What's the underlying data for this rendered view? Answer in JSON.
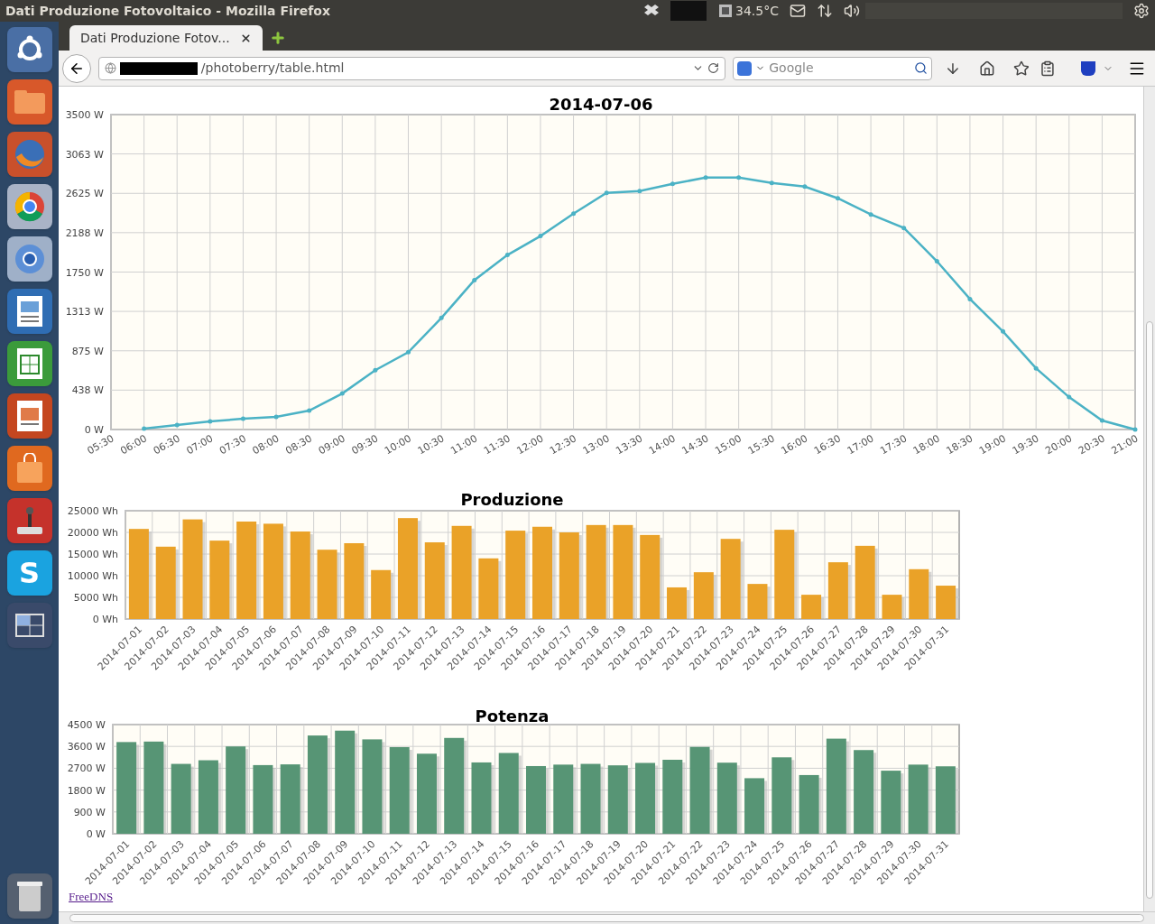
{
  "window": {
    "title": "Dati Produzione Fotovoltaico - Mozilla Firefox"
  },
  "panel": {
    "temperature": "34.5°C"
  },
  "launcher_items": [
    {
      "kind": "ubuntu"
    },
    {
      "kind": "folder"
    },
    {
      "kind": "fox"
    },
    {
      "kind": "ring"
    },
    {
      "kind": "ring-blue"
    },
    {
      "kind": "writer"
    },
    {
      "kind": "calc"
    },
    {
      "kind": "impress"
    },
    {
      "kind": "bag"
    },
    {
      "kind": "joystick"
    },
    {
      "kind": "letter",
      "label": "S"
    },
    {
      "kind": "workspaces"
    },
    {
      "kind": "trash"
    }
  ],
  "tabs": [
    {
      "label": "Dati Produzione Fotov...",
      "selected": true
    }
  ],
  "address_bar": {
    "value": "/photoberry/table.html"
  },
  "search": {
    "placeholder": "Google"
  },
  "charts": [
    {
      "chart_data": {
        "type": "line",
        "grid": true,
        "title": "2014-07-06",
        "categories": [
          "05:30",
          "06:00",
          "06:30",
          "07:00",
          "07:30",
          "08:00",
          "08:30",
          "09:00",
          "09:30",
          "10:00",
          "10:30",
          "11:00",
          "11:30",
          "12:00",
          "12:30",
          "13:00",
          "13:30",
          "14:00",
          "14:30",
          "15:00",
          "15:30",
          "16:00",
          "16:30",
          "17:00",
          "17:30",
          "18:00",
          "18:30",
          "19:00",
          "19:30",
          "20:00",
          "20:30",
          "21:00"
        ],
        "ylim": [
          0,
          3500
        ],
        "yticks": [
          {
            "value": 0,
            "label": "0 W"
          },
          {
            "value": 438,
            "label": "438 W"
          },
          {
            "value": 875,
            "label": "875 W"
          },
          {
            "value": 1313,
            "label": "1313 W"
          },
          {
            "value": 1750,
            "label": "1750 W"
          },
          {
            "value": 2188,
            "label": "2188 W"
          },
          {
            "value": 2625,
            "label": "2625 W"
          },
          {
            "value": 3063,
            "label": "3063 W"
          },
          {
            "value": 3500,
            "label": "3500 W"
          }
        ],
        "series": [
          {
            "color": "#4bb2c5",
            "values": [
              null,
              10,
              50,
              90,
              120,
              140,
              210,
              400,
              660,
              860,
              1240,
              1660,
              1940,
              2150,
              2400,
              2630,
              2650,
              2730,
              2800,
              2800,
              2740,
              2700,
              2570,
              2390,
              2240,
              1870,
              1450,
              1090,
              680,
              360,
              100,
              0
            ]
          }
        ]
      }
    },
    {
      "chart_data": {
        "type": "bar",
        "grid": true,
        "title": "Produzione",
        "categories": [
          "2014-07-01",
          "2014-07-02",
          "2014-07-03",
          "2014-07-04",
          "2014-07-05",
          "2014-07-06",
          "2014-07-07",
          "2014-07-08",
          "2014-07-09",
          "2014-07-10",
          "2014-07-11",
          "2014-07-12",
          "2014-07-13",
          "2014-07-14",
          "2014-07-15",
          "2014-07-16",
          "2014-07-17",
          "2014-07-18",
          "2014-07-19",
          "2014-07-20",
          "2014-07-21",
          "2014-07-22",
          "2014-07-23",
          "2014-07-24",
          "2014-07-25",
          "2014-07-26",
          "2014-07-27",
          "2014-07-28",
          "2014-07-29",
          "2014-07-30",
          "2014-07-31"
        ],
        "ylim": [
          0,
          25000
        ],
        "yticks": [
          {
            "value": 0,
            "label": "0 Wh"
          },
          {
            "value": 5000,
            "label": "5000 Wh"
          },
          {
            "value": 10000,
            "label": "10000 Wh"
          },
          {
            "value": 15000,
            "label": "15000 Wh"
          },
          {
            "value": 20000,
            "label": "20000 Wh"
          },
          {
            "value": 25000,
            "label": "25000 Wh"
          }
        ],
        "series": [
          {
            "color": "#eaa228",
            "values": [
              20800,
              16700,
              23000,
              18100,
              22500,
              22000,
              20200,
              16000,
              17500,
              11300,
              23300,
              17700,
              21500,
              14000,
              20400,
              21300,
              20000,
              21700,
              21700,
              19400,
              7300,
              10800,
              18500,
              8100,
              20600,
              5600,
              13100,
              16900,
              5600,
              11500,
              7700
            ]
          }
        ]
      }
    },
    {
      "chart_data": {
        "type": "bar",
        "grid": true,
        "title": "Potenza",
        "categories": [
          "2014-07-01",
          "2014-07-02",
          "2014-07-03",
          "2014-07-04",
          "2014-07-05",
          "2014-07-06",
          "2014-07-07",
          "2014-07-08",
          "2014-07-09",
          "2014-07-10",
          "2014-07-11",
          "2014-07-12",
          "2014-07-13",
          "2014-07-14",
          "2014-07-15",
          "2014-07-16",
          "2014-07-17",
          "2014-07-18",
          "2014-07-19",
          "2014-07-20",
          "2014-07-21",
          "2014-07-22",
          "2014-07-23",
          "2014-07-24",
          "2014-07-25",
          "2014-07-26",
          "2014-07-27",
          "2014-07-28",
          "2014-07-29",
          "2014-07-30",
          "2014-07-31"
        ],
        "ylim": [
          0,
          4500
        ],
        "yticks": [
          {
            "value": 0,
            "label": "0 W"
          },
          {
            "value": 900,
            "label": "900 W"
          },
          {
            "value": 1800,
            "label": "1800 W"
          },
          {
            "value": 2700,
            "label": "2700 W"
          },
          {
            "value": 3600,
            "label": "3600 W"
          },
          {
            "value": 4500,
            "label": "4500 W"
          }
        ],
        "series": [
          {
            "color": "#579575",
            "values": [
              3780,
              3800,
              2880,
              3030,
              3600,
              2830,
              2860,
              4050,
              4250,
              3890,
              3570,
              3300,
              3950,
              2940,
              3330,
              2790,
              2850,
              2880,
              2820,
              2920,
              3050,
              3580,
              2930,
              2290,
              3150,
              2420,
              3920,
              3450,
              2600,
              2850,
              2780
            ]
          }
        ]
      }
    }
  ],
  "footer_link": "FreeDNS"
}
